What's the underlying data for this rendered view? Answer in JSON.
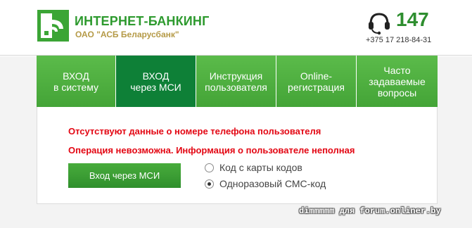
{
  "header": {
    "title": "ИНТЕРНЕТ-БАНКИНГ",
    "subtitle": "ОАО \"АСБ Беларусбанк\"",
    "phone_short": "147",
    "phone_full": "+375 17 218-84-31",
    "logo_icon": "bank-logo-icon",
    "headset_icon": "headset-icon"
  },
  "nav": {
    "items": [
      {
        "label": "ВХОД\nв систему",
        "active": false
      },
      {
        "label": "ВХОД\nчерез МСИ",
        "active": true
      },
      {
        "label": "Инструкция\nпользователя",
        "active": false
      },
      {
        "label": "Online-\nрегистрация",
        "active": false
      },
      {
        "label": "Часто\nзадаваемые\nвопросы",
        "active": false
      }
    ]
  },
  "messages": {
    "error1": "Отсутствуют данные о номере телефона пользователя",
    "error2": "Операция невозможна. Информация о пользователе неполная"
  },
  "form": {
    "submit_label": "Вход через МСИ",
    "options": [
      {
        "label": "Код с карты кодов",
        "checked": false
      },
      {
        "label": "Одноразовый СМС-код",
        "checked": true
      }
    ]
  },
  "watermark": "dimmmmm для forum.onliner.by",
  "colors": {
    "brand_green": "#3ba535",
    "nav_active": "#0e8037",
    "error_red": "#e30613",
    "subtitle_gold": "#b59a47"
  }
}
